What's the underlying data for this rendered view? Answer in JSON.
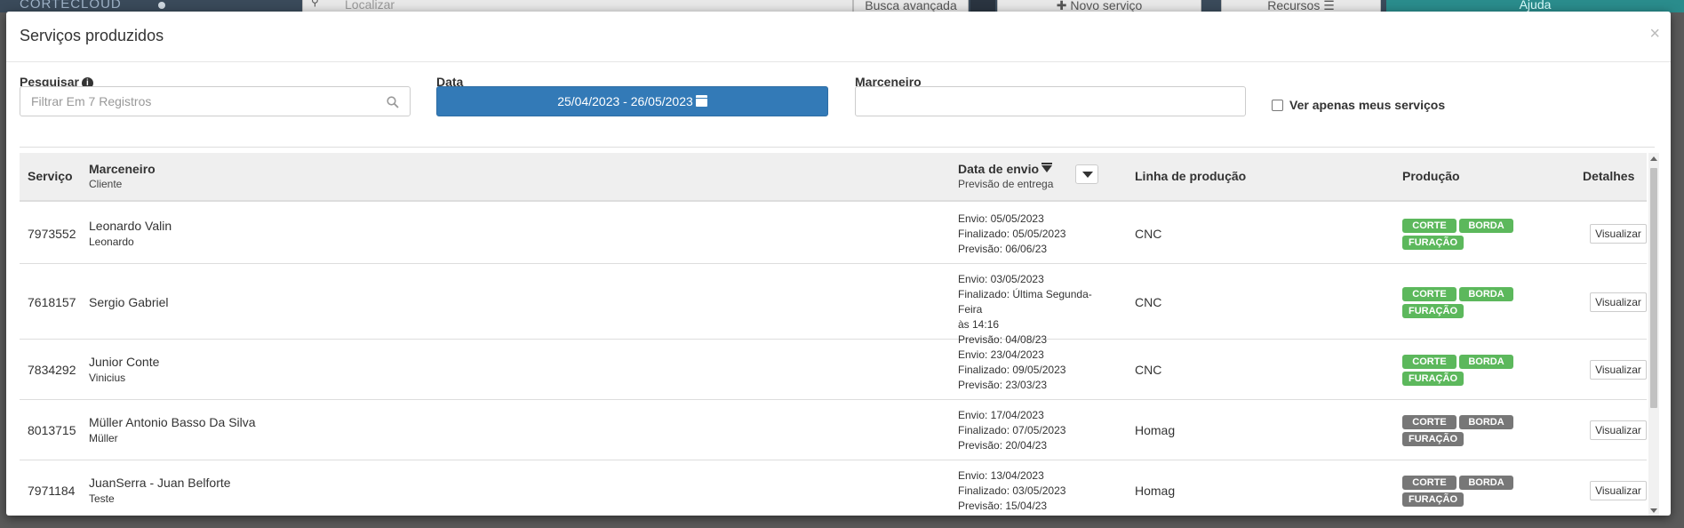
{
  "background": {
    "logo": "CORTECLOUD",
    "search_placeholder": "Localizar",
    "advanced_search": "Busca avançada",
    "new_service": "✚ Novo serviço",
    "resources": "Recursos ☰",
    "help": "Ajuda"
  },
  "modal": {
    "title": "Serviços produzidos",
    "close": "×"
  },
  "filters": {
    "search_label": "Pesquisar",
    "search_placeholder": "Filtrar Em 7 Registros",
    "date_label": "Data",
    "date_range": "25/04/2023 - 26/05/2023",
    "carpenter_label": "Marceneiro",
    "carpenter_value": "",
    "only_mine_label": "Ver apenas meus serviços"
  },
  "table": {
    "headers": {
      "service": "Serviço",
      "carpenter": "Marceneiro",
      "carpenter_sub": "Cliente",
      "ship_date": "Data de envio",
      "ship_date_sub": "Previsão de entrega",
      "line": "Linha de produção",
      "production": "Produção",
      "details": "Detalhes"
    },
    "rows": [
      {
        "service": "7973552",
        "carpenter": "Leonardo Valin",
        "client": "Leonardo",
        "dates": [
          "Envio: 05/05/2023",
          "Finalizado: 05/05/2023",
          "Previsão: 06/06/23"
        ],
        "line": "CNC",
        "badges": [
          "CORTE",
          "BORDA",
          "FURAÇÃO"
        ],
        "badge_color": "green",
        "details": "Visualizar"
      },
      {
        "service": "7618157",
        "carpenter": "Sergio Gabriel",
        "client": "",
        "dates": [
          "Envio: 03/05/2023",
          "Finalizado: Última Segunda-Feira",
          "às 14:16",
          "Previsão: 04/08/23"
        ],
        "line": "CNC",
        "badges": [
          "CORTE",
          "BORDA",
          "FURAÇÃO"
        ],
        "badge_color": "green",
        "details": "Visualizar"
      },
      {
        "service": "7834292",
        "carpenter": "Junior Conte",
        "client": "Vinicius",
        "dates": [
          "Envio: 23/04/2023",
          "Finalizado: 09/05/2023",
          "Previsão: 23/03/23"
        ],
        "line": "CNC",
        "badges": [
          "CORTE",
          "BORDA",
          "FURAÇÃO"
        ],
        "badge_color": "green",
        "details": "Visualizar"
      },
      {
        "service": "8013715",
        "carpenter": "Müller Antonio Basso Da Silva",
        "client": "Müller",
        "dates": [
          "Envio: 17/04/2023",
          "Finalizado: 07/05/2023",
          "Previsão: 20/04/23"
        ],
        "line": "Homag",
        "badges": [
          "CORTE",
          "BORDA",
          "FURAÇÃO"
        ],
        "badge_color": "gray",
        "details": "Visualizar"
      },
      {
        "service": "7971184",
        "carpenter": "JuanSerra - Juan Belforte",
        "client": "Teste",
        "dates": [
          "Envio: 13/04/2023",
          "Finalizado: 03/05/2023",
          "Previsão: 15/04/23"
        ],
        "line": "Homag",
        "badges": [
          "CORTE",
          "BORDA",
          "FURAÇÃO"
        ],
        "badge_color": "gray",
        "details": "Visualizar"
      }
    ]
  },
  "colors": {
    "primary": "#337ab7",
    "badge_green": "#5cb85c",
    "badge_gray": "#777777"
  }
}
